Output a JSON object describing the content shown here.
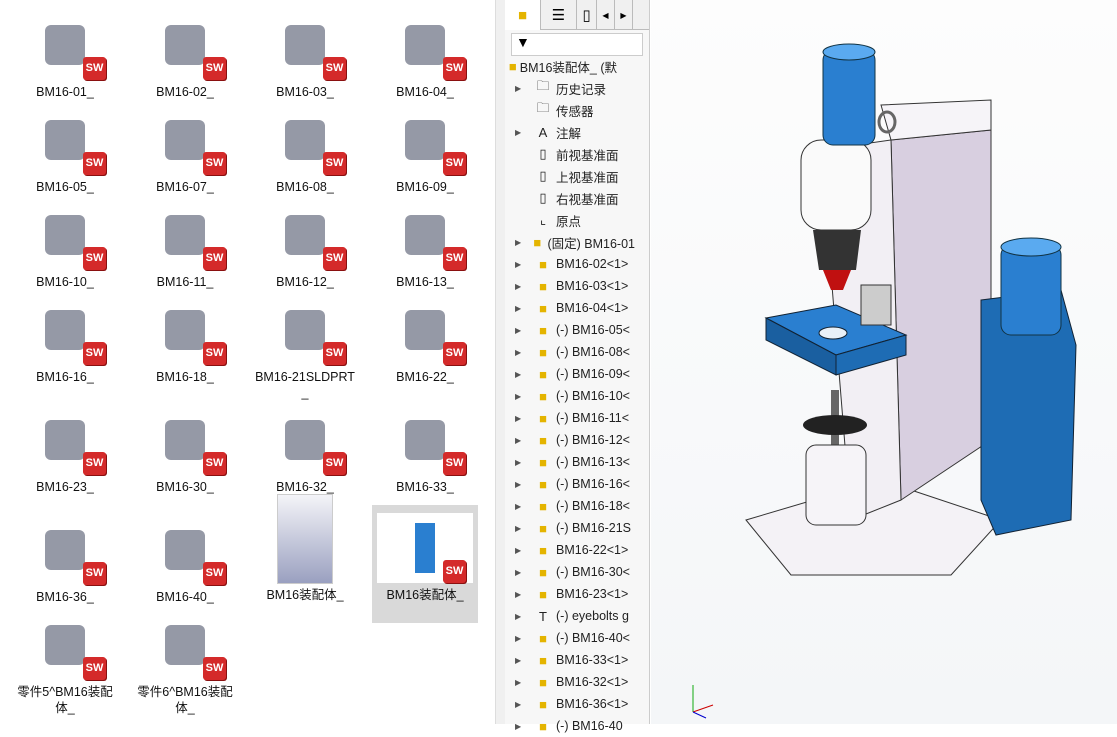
{
  "files": [
    {
      "name": "BM16-01_",
      "kind": "part"
    },
    {
      "name": "BM16-02_",
      "kind": "part"
    },
    {
      "name": "BM16-03_",
      "kind": "part"
    },
    {
      "name": "BM16-04_",
      "kind": "part"
    },
    {
      "name": "BM16-05_",
      "kind": "part"
    },
    {
      "name": "BM16-07_",
      "kind": "part"
    },
    {
      "name": "BM16-08_",
      "kind": "part"
    },
    {
      "name": "BM16-09_",
      "kind": "part"
    },
    {
      "name": "BM16-10_",
      "kind": "part"
    },
    {
      "name": "BM16-11_",
      "kind": "part"
    },
    {
      "name": "BM16-12_",
      "kind": "part"
    },
    {
      "name": "BM16-13_",
      "kind": "part"
    },
    {
      "name": "BM16-16_",
      "kind": "part"
    },
    {
      "name": "BM16-18_",
      "kind": "part"
    },
    {
      "name": "BM16-21SLDPRT_",
      "kind": "part"
    },
    {
      "name": "BM16-22_",
      "kind": "part"
    },
    {
      "name": "BM16-23_",
      "kind": "part"
    },
    {
      "name": "BM16-30_",
      "kind": "part"
    },
    {
      "name": "BM16-32_",
      "kind": "part"
    },
    {
      "name": "BM16-33_",
      "kind": "part"
    },
    {
      "name": "BM16-36_",
      "kind": "part"
    },
    {
      "name": "BM16-40_",
      "kind": "part"
    },
    {
      "name": "BM16装配体_",
      "kind": "image"
    },
    {
      "name": "BM16装配体_",
      "kind": "assembly"
    },
    {
      "name": "零件5^BM16装配体_",
      "kind": "part"
    },
    {
      "name": "零件6^BM16装配体_",
      "kind": "part"
    }
  ],
  "sw_badge": "SW",
  "tree": {
    "tabs": [
      "feature-manager",
      "property-manager",
      "config-manager"
    ],
    "filter": "▼",
    "root": "BM16装配体_ (默",
    "items": [
      {
        "label": "历史记录",
        "icon": "history-folder",
        "arrow": true
      },
      {
        "label": "传感器",
        "icon": "sensor-folder",
        "arrow": false
      },
      {
        "label": "注解",
        "icon": "annotation-folder",
        "arrow": true
      },
      {
        "label": "前视基准面",
        "icon": "plane",
        "arrow": false
      },
      {
        "label": "上视基准面",
        "icon": "plane",
        "arrow": false
      },
      {
        "label": "右视基准面",
        "icon": "plane",
        "arrow": false
      },
      {
        "label": "原点",
        "icon": "origin",
        "arrow": false
      },
      {
        "label": "(固定) BM16-01",
        "icon": "part",
        "arrow": true
      },
      {
        "label": "BM16-02<1>",
        "icon": "part",
        "arrow": true
      },
      {
        "label": "BM16-03<1>",
        "icon": "part",
        "arrow": true
      },
      {
        "label": "BM16-04<1>",
        "icon": "part",
        "arrow": true
      },
      {
        "label": "(-) BM16-05<",
        "icon": "part",
        "arrow": true
      },
      {
        "label": "(-) BM16-08<",
        "icon": "part",
        "arrow": true
      },
      {
        "label": "(-) BM16-09<",
        "icon": "part",
        "arrow": true
      },
      {
        "label": "(-) BM16-10<",
        "icon": "part",
        "arrow": true
      },
      {
        "label": "(-) BM16-11<",
        "icon": "part",
        "arrow": true
      },
      {
        "label": "(-) BM16-12<",
        "icon": "part",
        "arrow": true
      },
      {
        "label": "(-) BM16-13<",
        "icon": "part",
        "arrow": true
      },
      {
        "label": "(-) BM16-16<",
        "icon": "part",
        "arrow": true
      },
      {
        "label": "(-) BM16-18<",
        "icon": "part",
        "arrow": true
      },
      {
        "label": "(-) BM16-21S",
        "icon": "part",
        "arrow": true
      },
      {
        "label": "BM16-22<1>",
        "icon": "part",
        "arrow": true
      },
      {
        "label": "(-) BM16-30<",
        "icon": "part",
        "arrow": true
      },
      {
        "label": "BM16-23<1>",
        "icon": "part",
        "arrow": true
      },
      {
        "label": "(-) eyebolts g",
        "icon": "bolt",
        "arrow": true
      },
      {
        "label": "(-) BM16-40<",
        "icon": "part",
        "arrow": true
      },
      {
        "label": "BM16-33<1>",
        "icon": "part",
        "arrow": true
      },
      {
        "label": "BM16-32<1>",
        "icon": "part",
        "arrow": true
      },
      {
        "label": "BM16-36<1>",
        "icon": "part",
        "arrow": true
      },
      {
        "label": "(-) BM16-40",
        "icon": "part",
        "arrow": true
      }
    ]
  },
  "colors": {
    "accent": "#1e7fd6",
    "sw_red": "#d42a2a",
    "part_yellow": "#e4b400",
    "motor_blue": "#2a7fd0"
  }
}
